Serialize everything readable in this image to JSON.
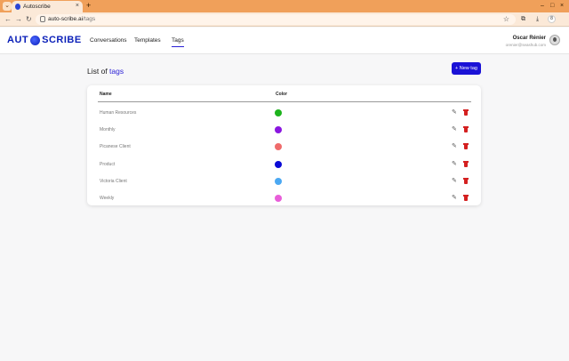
{
  "browser": {
    "tab_title": "Autoscribe",
    "tab_close": "×",
    "new_tab": "+",
    "url_host": "auto-scribe.ai",
    "url_path": "/tags",
    "back": "←",
    "forward": "→",
    "reload": "↻",
    "star": "☆",
    "minimize": "–",
    "maximize": "□",
    "close": "×",
    "profile_initial": "8"
  },
  "header": {
    "logo_left": "AUT",
    "logo_right": "SCRIBE",
    "nav": [
      {
        "label": "Conversations"
      },
      {
        "label": "Templates"
      },
      {
        "label": "Tags"
      }
    ],
    "user_name": "Oscar Rénier",
    "user_email": "orenier@seashub.com"
  },
  "page": {
    "title_prefix": "List of ",
    "title_accent": "tags",
    "new_tag_label": "+ New tag"
  },
  "table": {
    "columns": [
      "Name",
      "Color"
    ],
    "rows": [
      {
        "name": "Human Resources",
        "color": "#1db31d"
      },
      {
        "name": "Monthly",
        "color": "#8a16e0"
      },
      {
        "name": "Picanese Client",
        "color": "#ef6b6b"
      },
      {
        "name": "Product",
        "color": "#0a0ad6"
      },
      {
        "name": "Victoria Client",
        "color": "#4ba8f2"
      },
      {
        "name": "Weekly",
        "color": "#e85ed9"
      }
    ]
  },
  "colors": {
    "accent": "#2a1fd6",
    "delete": "#d42020"
  }
}
